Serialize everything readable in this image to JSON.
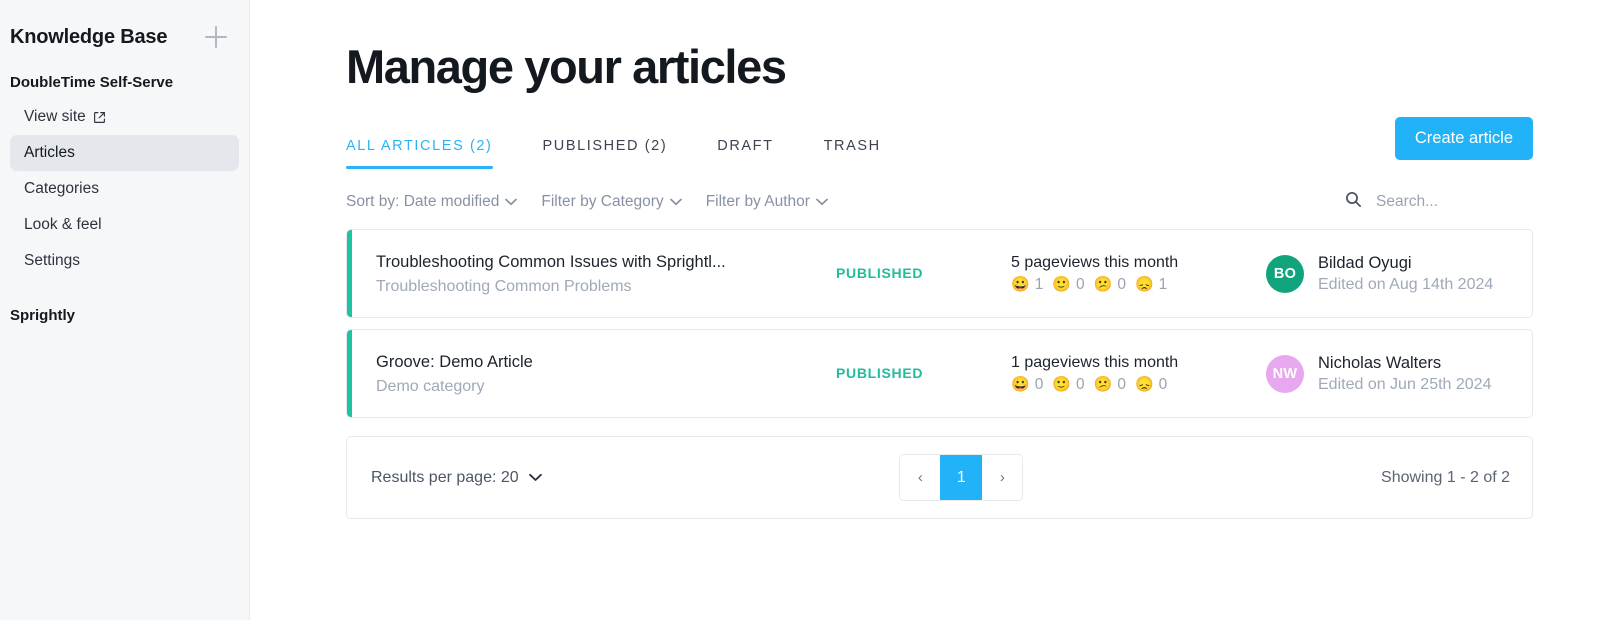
{
  "sidebar": {
    "title": "Knowledge Base",
    "add_icon": "plus-icon",
    "site_name": "DoubleTime Self-Serve",
    "items": [
      {
        "label": "View site",
        "icon": "external-link-icon",
        "active": false
      },
      {
        "label": "Articles",
        "icon": "",
        "active": true
      },
      {
        "label": "Categories",
        "icon": "",
        "active": false
      },
      {
        "label": "Look & feel",
        "icon": "",
        "active": false
      },
      {
        "label": "Settings",
        "icon": "",
        "active": false
      }
    ],
    "second_site_name": "Sprightly"
  },
  "header": {
    "title": "Manage your articles",
    "create_button": "Create article"
  },
  "tabs": [
    {
      "label": "ALL ARTICLES (2)",
      "active": true
    },
    {
      "label": "PUBLISHED (2)",
      "active": false
    },
    {
      "label": "DRAFT",
      "active": false
    },
    {
      "label": "TRASH",
      "active": false
    }
  ],
  "filters": {
    "sort_by": "Sort by: Date modified",
    "filter_category": "Filter by Category",
    "filter_author": "Filter by Author",
    "search_icon": "search-icon",
    "search_value": "",
    "search_placeholder": "Search..."
  },
  "articles": [
    {
      "title": "Troubleshooting Common Issues with Sprightl...",
      "category": "Troubleshooting Common Problems",
      "status": "PUBLISHED",
      "pageviews": "5 pageviews this month",
      "reactions": [
        {
          "emoji": "😀",
          "name": "grinning-face",
          "count": "1"
        },
        {
          "emoji": "🙂",
          "name": "slightly-smiling-face",
          "count": "0"
        },
        {
          "emoji": "😕",
          "name": "confused-face",
          "count": "0"
        },
        {
          "emoji": "😞",
          "name": "disappointed-face",
          "count": "1"
        }
      ],
      "author": "Bildad Oyugi",
      "initials": "BO",
      "avatar_color": "#11a47c",
      "edited": "Edited on Aug 14th 2024",
      "accent_color": "#1fc3a0"
    },
    {
      "title": "Groove: Demo Article",
      "category": "Demo category",
      "status": "PUBLISHED",
      "pageviews": "1 pageviews this month",
      "reactions": [
        {
          "emoji": "😀",
          "name": "grinning-face",
          "count": "0"
        },
        {
          "emoji": "🙂",
          "name": "slightly-smiling-face",
          "count": "0"
        },
        {
          "emoji": "😕",
          "name": "confused-face",
          "count": "0"
        },
        {
          "emoji": "😞",
          "name": "disappointed-face",
          "count": "0"
        }
      ],
      "author": "Nicholas Walters",
      "initials": "NW",
      "avatar_color": "#e8a8f0",
      "edited": "Edited on Jun 25th 2024",
      "accent_color": "#1fc3a0"
    }
  ],
  "pagination": {
    "results_per_page": "Results per page: 20",
    "prev": "‹",
    "current_page": "1",
    "next": "›",
    "showing": "Showing 1 - 2 of 2"
  },
  "colors": {
    "accent_blue": "#22b2f8",
    "status_green": "#1fbd9c",
    "card_accent": "#1fc3a0",
    "sidebar_bg": "#f6f7f9"
  }
}
